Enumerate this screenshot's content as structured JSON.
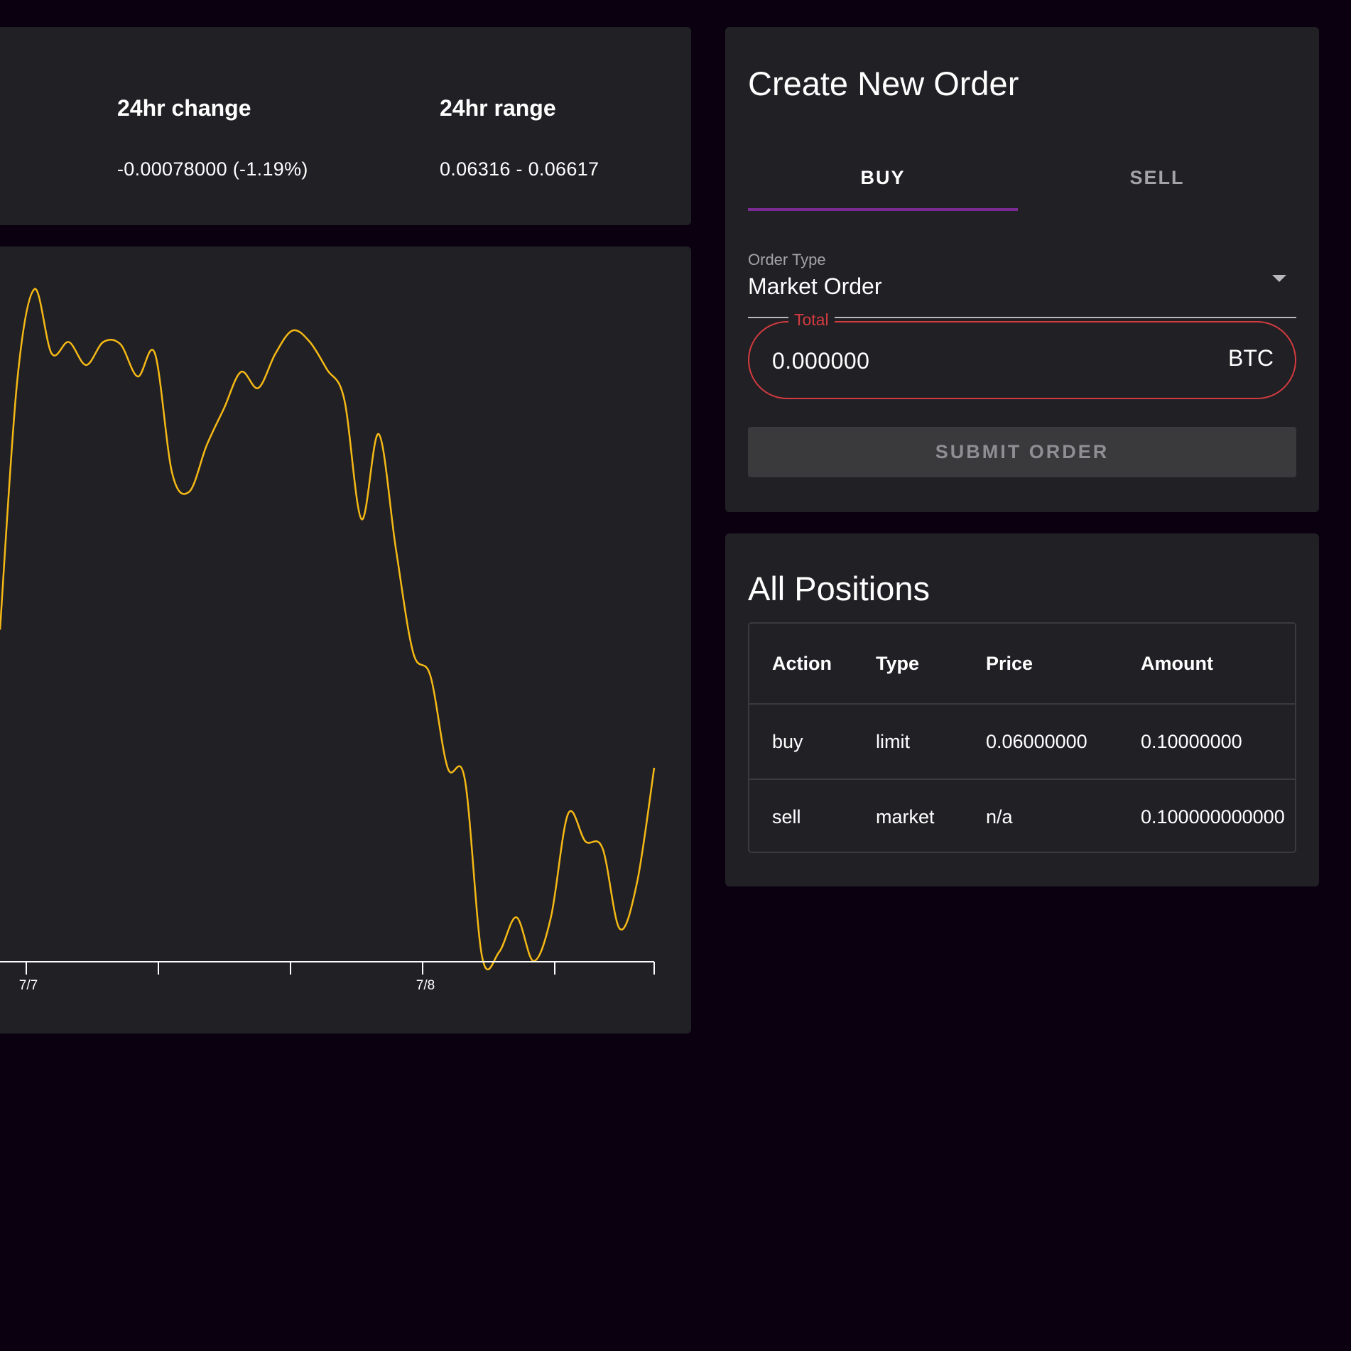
{
  "stats": {
    "change_label": "24hr change",
    "change_value": "-0.00078000 (-1.19%)",
    "range_label": "24hr range",
    "range_value": "0.06316 - 0.06617"
  },
  "chart_data": {
    "type": "line",
    "title": "",
    "x_tick_labels": [
      "7/7",
      "7/8"
    ],
    "line_color": "#f5b915",
    "series": [
      {
        "values": [
          0.0646,
          0.06568,
          0.06608,
          0.0658,
          0.06585,
          0.06575,
          0.06585,
          0.06584,
          0.0657,
          0.0658,
          0.06528,
          0.0652,
          0.0654,
          0.06556,
          0.06572,
          0.06565,
          0.0658,
          0.0659,
          0.06585,
          0.06573,
          0.0656,
          0.06508,
          0.06545,
          0.06495,
          0.0645,
          0.0644,
          0.064,
          0.06395,
          0.06318,
          0.0632,
          0.06335,
          0.06316,
          0.06335,
          0.0638,
          0.06368,
          0.06365,
          0.0633,
          0.0635,
          0.064
        ]
      }
    ]
  },
  "order": {
    "title": "Create New Order",
    "tab_buy": "BUY",
    "tab_sell": "SELL",
    "order_type_label": "Order Type",
    "order_type_value": "Market Order",
    "total_label": "Total",
    "total_value": "0.000000",
    "total_unit": "BTC",
    "submit_label": "SUBMIT ORDER"
  },
  "positions": {
    "title": "All Positions",
    "headers": [
      "Action",
      "Type",
      "Price",
      "Amount"
    ],
    "rows": [
      [
        "buy",
        "limit",
        "0.06000000",
        "0.10000000"
      ],
      [
        "sell",
        "market",
        "n/a",
        "0.100000000000"
      ]
    ]
  }
}
